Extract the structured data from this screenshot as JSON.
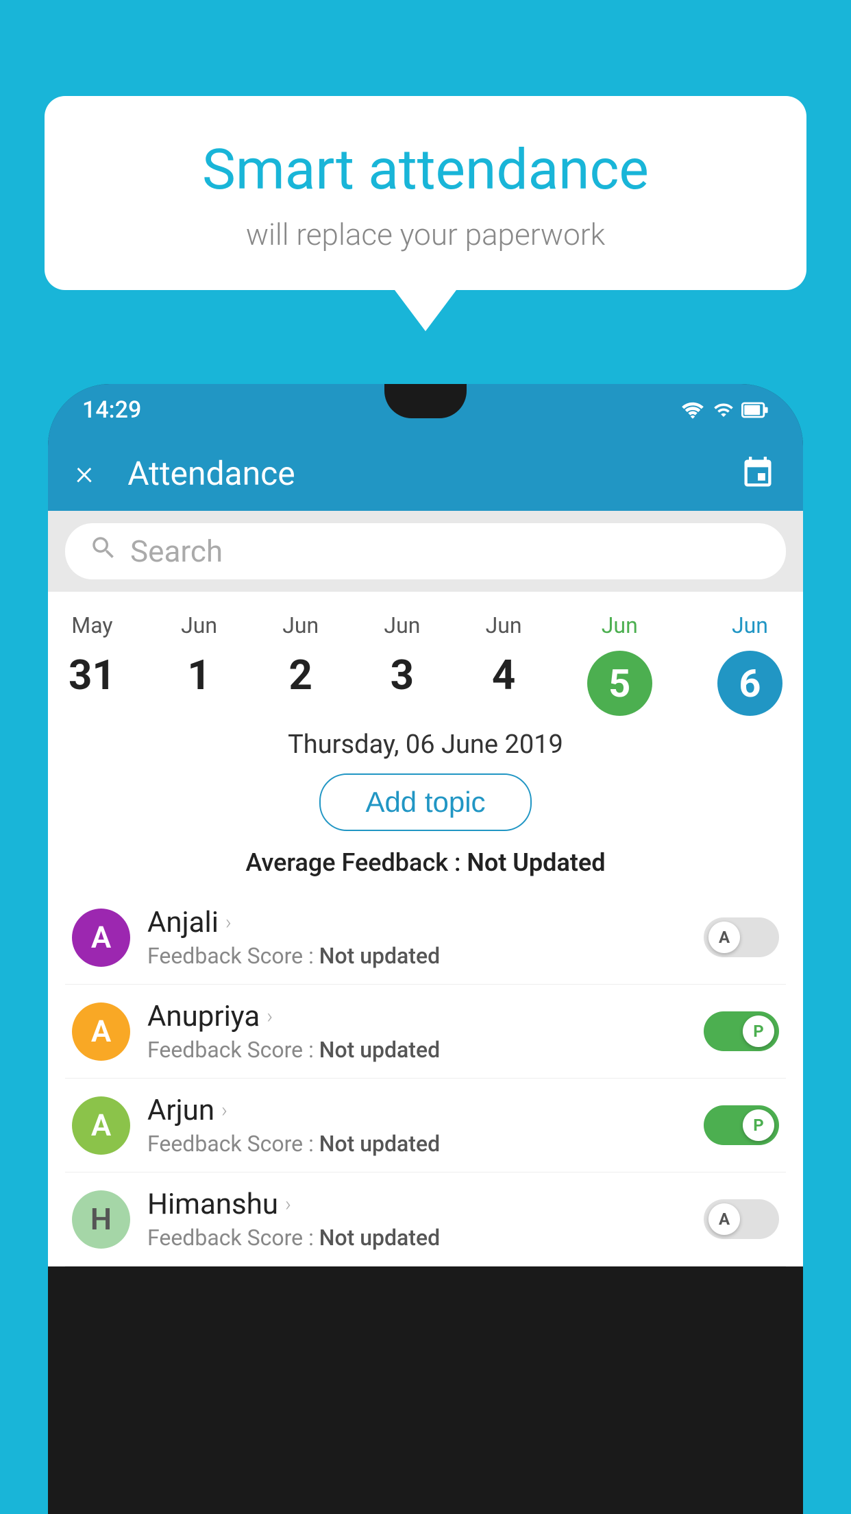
{
  "background_color": "#19b5d8",
  "speech_bubble": {
    "title": "Smart attendance",
    "subtitle": "will replace your paperwork"
  },
  "status_bar": {
    "time": "14:29"
  },
  "app_bar": {
    "title": "Attendance",
    "close_label": "×"
  },
  "search": {
    "placeholder": "Search"
  },
  "dates": [
    {
      "month": "May",
      "day": "31",
      "selected": false
    },
    {
      "month": "Jun",
      "day": "1",
      "selected": false
    },
    {
      "month": "Jun",
      "day": "2",
      "selected": false
    },
    {
      "month": "Jun",
      "day": "3",
      "selected": false
    },
    {
      "month": "Jun",
      "day": "4",
      "selected": false
    },
    {
      "month": "Jun",
      "day": "5",
      "selected": "green"
    },
    {
      "month": "Jun",
      "day": "6",
      "selected": "blue"
    }
  ],
  "selected_date": "Thursday, 06 June 2019",
  "add_topic_label": "Add topic",
  "avg_feedback_label": "Average Feedback : ",
  "avg_feedback_value": "Not Updated",
  "students": [
    {
      "name": "Anjali",
      "avatar_letter": "A",
      "avatar_color": "#9c27b0",
      "feedback_label": "Feedback Score : ",
      "feedback_value": "Not updated",
      "toggle": "off",
      "toggle_letter": "A"
    },
    {
      "name": "Anupriya",
      "avatar_letter": "A",
      "avatar_color": "#f9a825",
      "feedback_label": "Feedback Score : ",
      "feedback_value": "Not updated",
      "toggle": "on",
      "toggle_letter": "P"
    },
    {
      "name": "Arjun",
      "avatar_letter": "A",
      "avatar_color": "#8bc34a",
      "feedback_label": "Feedback Score : ",
      "feedback_value": "Not updated",
      "toggle": "on",
      "toggle_letter": "P"
    },
    {
      "name": "Himanshu",
      "avatar_letter": "H",
      "avatar_color": "#a5d6a7",
      "feedback_label": "Feedback Score : ",
      "feedback_value": "Not updated",
      "toggle": "off",
      "toggle_letter": "A"
    }
  ]
}
